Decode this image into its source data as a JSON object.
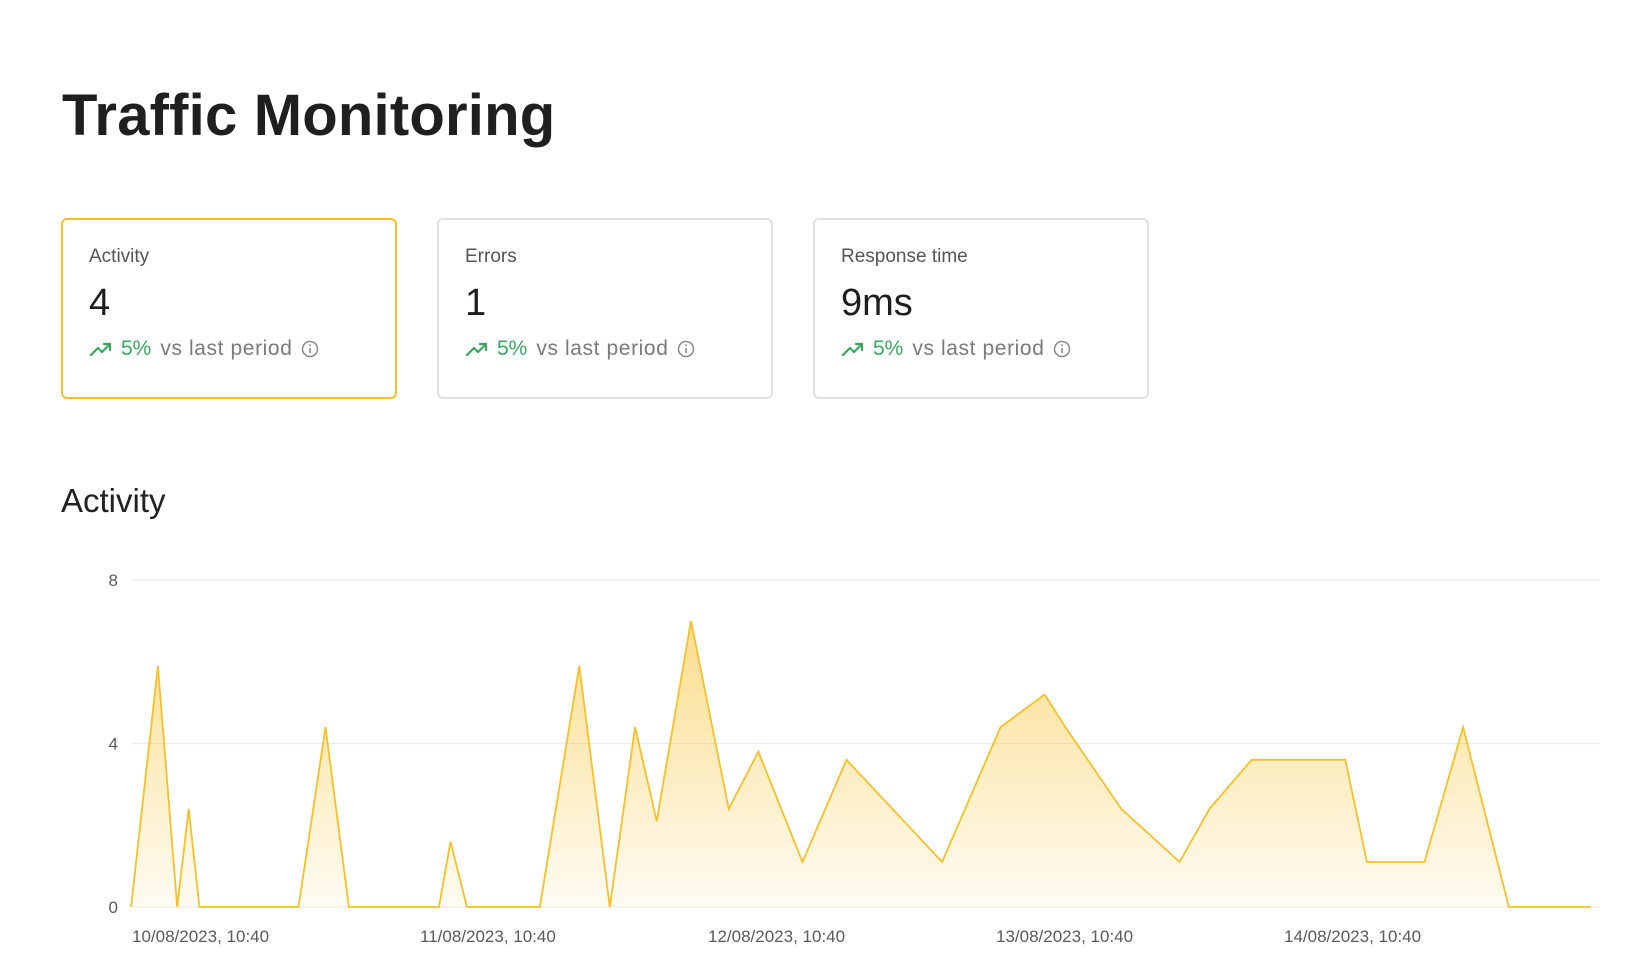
{
  "page": {
    "title": "Traffic Monitoring"
  },
  "cards": [
    {
      "label": "Activity",
      "value": "4",
      "trend_pct": "5%",
      "trend_text": "vs last period",
      "active": true
    },
    {
      "label": "Errors",
      "value": "1",
      "trend_pct": "5%",
      "trend_text": "vs last period",
      "active": false
    },
    {
      "label": "Response time",
      "value": "9ms",
      "trend_pct": "5%",
      "trend_text": "vs last period",
      "active": false
    }
  ],
  "icons": {
    "trend": "trending-up-icon",
    "info": "info-icon"
  },
  "colors": {
    "accent": "#f5c12a",
    "positive": "#3aa660"
  },
  "section": {
    "title": "Activity"
  },
  "chart_data": {
    "type": "area",
    "title": "Activity",
    "y_ticks": [
      "8",
      "4",
      "0"
    ],
    "ylim": [
      0,
      8
    ],
    "x_tick_labels": [
      "10/08/2023, 10:40",
      "11/08/2023, 10:40",
      "12/08/2023, 10:40",
      "13/08/2023, 10:40",
      "14/08/2023, 10:40"
    ],
    "x_days_range": [
      -0.1,
      5.0
    ],
    "grid": true,
    "color": "#f5c12a",
    "points": [
      [
        -0.003,
        0
      ],
      [
        0.09,
        5.9
      ],
      [
        0.157,
        0
      ],
      [
        0.197,
        2.4
      ],
      [
        0.234,
        0
      ],
      [
        0.578,
        0
      ],
      [
        0.672,
        4.4
      ],
      [
        0.753,
        0
      ],
      [
        1.066,
        0
      ],
      [
        1.106,
        1.6
      ],
      [
        1.163,
        0
      ],
      [
        1.416,
        0
      ],
      [
        1.553,
        5.9
      ],
      [
        1.659,
        0
      ],
      [
        1.747,
        4.4
      ],
      [
        1.822,
        2.1
      ],
      [
        1.941,
        7.0
      ],
      [
        2.072,
        2.4
      ],
      [
        2.175,
        3.8
      ],
      [
        2.328,
        1.1
      ],
      [
        2.481,
        3.6
      ],
      [
        2.813,
        1.1
      ],
      [
        3.016,
        4.4
      ],
      [
        3.169,
        5.2
      ],
      [
        3.241,
        4.4
      ],
      [
        3.435,
        2.4
      ],
      [
        3.638,
        1.1
      ],
      [
        3.741,
        2.4
      ],
      [
        3.888,
        3.6
      ],
      [
        4.213,
        3.6
      ],
      [
        4.288,
        1.1
      ],
      [
        4.488,
        1.1
      ],
      [
        4.622,
        4.4
      ],
      [
        4.781,
        0
      ],
      [
        5.066,
        0
      ]
    ]
  }
}
